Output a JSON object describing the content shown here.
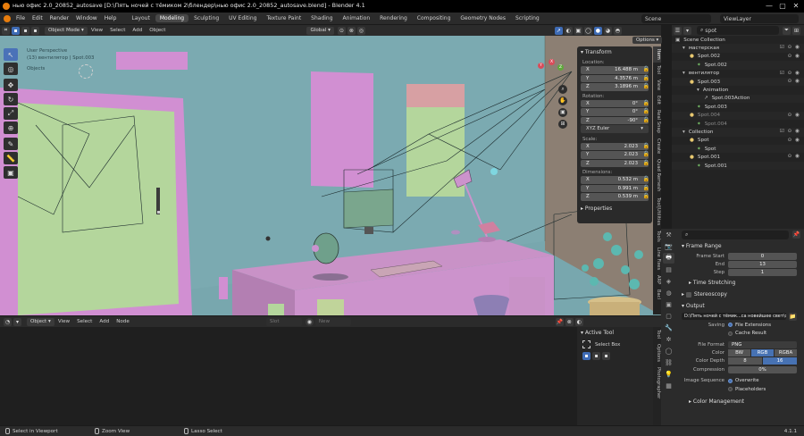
{
  "title_bar": {
    "title": "нью офис 2.0_20852_autosave [D:\\Пять ночей с тёмиком 2\\блендер\\нью офис 2.0_20852_autosave.blend] - Blender 4.1",
    "buttons": [
      "—",
      "▢",
      "✕"
    ]
  },
  "menu": {
    "items": [
      "File",
      "Edit",
      "Render",
      "Window",
      "Help"
    ],
    "workspaces": [
      "Layout",
      "Modeling",
      "Sculpting",
      "UV Editing",
      "Texture Paint",
      "Shading",
      "Animation",
      "Rendering",
      "Compositing",
      "Geometry Nodes",
      "Scripting"
    ],
    "active_workspace": "Modeling",
    "scene": "Scene",
    "view_layer": "ViewLayer"
  },
  "viewport_header": {
    "mode": "Object Mode",
    "menus": [
      "View",
      "Select",
      "Add",
      "Object"
    ],
    "orientation": "Global",
    "options": "Options"
  },
  "viewport": {
    "view_name": "User Perspective",
    "collection_info": "(13) вентилятор | Spot.003",
    "scene_stats": "Objects",
    "gizmo_axes": [
      "Y",
      "X",
      "Z"
    ]
  },
  "npanel": {
    "transform_title": "Transform",
    "location_label": "Location:",
    "location": [
      {
        "axis": "X",
        "value": "16.488 m"
      },
      {
        "axis": "Y",
        "value": "4.3576 m"
      },
      {
        "axis": "Z",
        "value": "3.1896 m"
      }
    ],
    "rotation_label": "Rotation:",
    "rotation": [
      {
        "axis": "X",
        "value": "0°"
      },
      {
        "axis": "Y",
        "value": "0°"
      },
      {
        "axis": "Z",
        "value": "-90°"
      }
    ],
    "rotation_mode": "XYZ Euler",
    "scale_label": "Scale:",
    "scale": [
      {
        "axis": "X",
        "value": "2.023"
      },
      {
        "axis": "Y",
        "value": "2.023"
      },
      {
        "axis": "Z",
        "value": "2.023"
      }
    ],
    "dimensions_label": "Dimensions:",
    "dimensions": [
      {
        "axis": "X",
        "value": "0.532 m"
      },
      {
        "axis": "Y",
        "value": "0.991 m"
      },
      {
        "axis": "Z",
        "value": "0.539 m"
      }
    ],
    "properties_title": "Properties"
  },
  "side_tabs": [
    "Item",
    "Tool",
    "View",
    "Edit",
    "Real Snap",
    "Create",
    "Quad Remesh",
    "Tool|Utilities",
    "Tools",
    "Line Fixes",
    "ARP",
    "Bacl"
  ],
  "node_editor": {
    "header_items": [
      "Object",
      "View",
      "Select",
      "Add",
      "Node"
    ],
    "slot_label": "Slot",
    "new_label": "New",
    "active_tool_title": "Active Tool",
    "active_tool_name": "Select Box",
    "side_tabs": [
      "Tool",
      "Options",
      "Photographer"
    ]
  },
  "outliner": {
    "search": "spot",
    "rows": [
      {
        "indent": 0,
        "icon": "▣",
        "label": "Scene Collection",
        "icons": ""
      },
      {
        "indent": 1,
        "icon": "▾",
        "label": "мастерская",
        "icons": "☑ ⊙ ◉"
      },
      {
        "indent": 2,
        "icon": "●",
        "label": "Spot.002",
        "icons": "⊙ ◉"
      },
      {
        "indent": 3,
        "icon": "✦",
        "label": "Spot.002",
        "icons": ""
      },
      {
        "indent": 1,
        "icon": "▾",
        "label": "вентилятор",
        "icons": "☑ ⊙ ◉"
      },
      {
        "indent": 2,
        "icon": "●",
        "label": "Spot.003",
        "icons": "⊙ ◉"
      },
      {
        "indent": 3,
        "icon": "▾",
        "label": "Animation",
        "icons": ""
      },
      {
        "indent": 4,
        "icon": "↗",
        "label": "Spot.003Action",
        "icons": ""
      },
      {
        "indent": 3,
        "icon": "✦",
        "label": "Spot.003",
        "icons": ""
      },
      {
        "indent": 2,
        "icon": "●",
        "label": "Spot.004",
        "icons": "⊙ ◉"
      },
      {
        "indent": 3,
        "icon": "✦",
        "label": "Spot.004",
        "icons": ""
      },
      {
        "indent": 1,
        "icon": "▾",
        "label": "Collection",
        "icons": "☑ ⊙ ◉"
      },
      {
        "indent": 2,
        "icon": "●",
        "label": "Spot",
        "icons": "⊙ ◉"
      },
      {
        "indent": 3,
        "icon": "✦",
        "label": "Spot",
        "icons": ""
      },
      {
        "indent": 2,
        "icon": "●",
        "label": "Spot.001",
        "icons": "⊙ ◉"
      },
      {
        "indent": 3,
        "icon": "✦",
        "label": "Spot.001",
        "icons": ""
      }
    ]
  },
  "properties": {
    "frame_range_title": "Frame Range",
    "frame_start_label": "Frame Start",
    "frame_start": "0",
    "end_label": "End",
    "end": "13",
    "step_label": "Step",
    "step": "1",
    "time_stretching": "Time Stretching",
    "stereoscopy": "Stereoscopy",
    "output_title": "Output",
    "output_path": "D:\\Пять ночей с тёмик...са новейшее свет\\офис",
    "saving_label": "Saving",
    "file_extensions": "File Extensions",
    "cache_result": "Cache Result",
    "file_format_label": "File Format",
    "file_format": "PNG",
    "color_label": "Color",
    "color_options": [
      "BW",
      "RGB",
      "RGBA"
    ],
    "color_selected": "RGB",
    "color_depth_label": "Color Depth",
    "color_depth_options": [
      "8",
      "16"
    ],
    "color_depth_selected": "16",
    "compression_label": "Compression",
    "compression": "0%",
    "image_sequence_label": "Image Sequence",
    "overwrite": "Overwrite",
    "placeholders": "Placeholders",
    "color_management": "Color Management"
  },
  "status_bar": {
    "select": "Select in Viewport",
    "zoom": "Zoom View",
    "lasso": "Lasso Select",
    "version": "4.1.1"
  }
}
